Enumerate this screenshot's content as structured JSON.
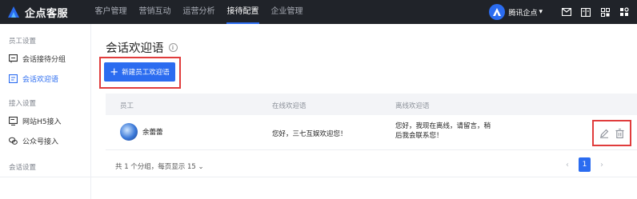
{
  "brand": {
    "name": "企点客服"
  },
  "topnav": [
    {
      "label": "客户管理",
      "active": false
    },
    {
      "label": "营销互动",
      "active": false
    },
    {
      "label": "运营分析",
      "active": false
    },
    {
      "label": "接待配置",
      "active": true
    },
    {
      "label": "企业管理",
      "active": false
    }
  ],
  "account": {
    "name": "腾讯企点",
    "caret": "▾"
  },
  "sidebar": {
    "group1": "员工设置",
    "item1": "会话接待分组",
    "item2": "会话欢迎语",
    "group2": "接入设置",
    "item3": "网站H5接入",
    "item4": "公众号接入",
    "group3": "会话设置"
  },
  "page": {
    "title": "会话欢迎语",
    "info_glyph": "i",
    "add_button": "新建员工欢迎语",
    "add_glyph": "+"
  },
  "table": {
    "headers": {
      "employee": "员工",
      "online": "在线欢迎语",
      "offline": "离线欢迎语"
    },
    "rows": [
      {
        "employee": "余蕾蕾",
        "online": "您好，三七互娱欢迎您！",
        "offline": "您好，我现在离线，请留言，稍后我会联系您！"
      }
    ]
  },
  "footer": {
    "summary": "共 1 个分组，每页显示 15 ⌄"
  },
  "pagination": {
    "prev": "‹",
    "current": "1",
    "next": "›"
  },
  "colors": {
    "accent": "#2b6cf0",
    "topbar": "#202329",
    "highlight": "#e03c3c"
  },
  "icons": [
    "logo-icon",
    "mail-icon",
    "book-icon",
    "grid-icon",
    "settings-icon",
    "chat-group-icon",
    "welcome-icon",
    "monitor-icon",
    "wechat-icon",
    "info-icon",
    "edit-icon",
    "delete-icon"
  ]
}
